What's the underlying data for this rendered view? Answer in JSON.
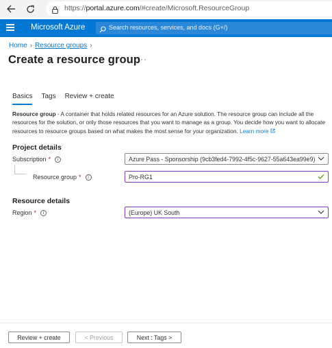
{
  "browser": {
    "url_prefix": "https://",
    "url_host": "portal.azure.com",
    "url_path": "/#create/Microsoft.ResourceGroup"
  },
  "header": {
    "brand": "Microsoft Azure",
    "search_placeholder": "Search resources, services, and docs (G+/)",
    "color": "#0078d4"
  },
  "breadcrumb": {
    "home": "Home",
    "resource_groups": "Resource groups"
  },
  "page": {
    "title": "Create a resource group",
    "more": "···"
  },
  "tabs": [
    {
      "label": "Basics",
      "active": true
    },
    {
      "label": "Tags",
      "active": false
    },
    {
      "label": "Review + create",
      "active": false
    }
  ],
  "description": {
    "term": "Resource group",
    "text": " - A container that holds related resources for an Azure solution. The resource group can include all the resources for the solution, or only those resources that you want to manage as a group. You decide how you want to allocate resources to resource groups based on what makes the most sense for your organization. ",
    "learn_more": "Learn more"
  },
  "project_details": {
    "title": "Project details",
    "subscription_label": "Subscription",
    "subscription_value": "Azure Pass - Sponsorship (9cb3fed4-7992-4f5c-9627-55a643ea99e9)",
    "resource_group_label": "Resource group",
    "resource_group_value": "Pro-RG1",
    "required_mark": "*"
  },
  "resource_details": {
    "title": "Resource details",
    "region_label": "Region",
    "region_value": "(Europe) UK South",
    "required_mark": "*"
  },
  "footer": {
    "review_create": "Review + create",
    "previous": "< Previous",
    "next": "Next : Tags >"
  }
}
